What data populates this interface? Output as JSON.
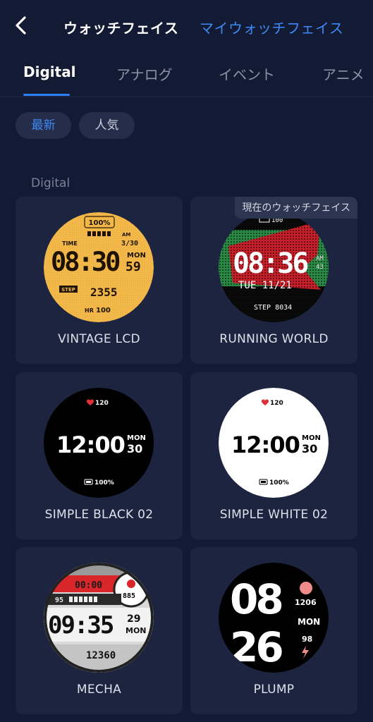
{
  "header": {
    "back_icon": "chevron-left-icon",
    "title": "ウォッチフェイス",
    "my_faces_link": "マイウォッチフェイス"
  },
  "tabs": [
    {
      "label": "Digital",
      "active": true
    },
    {
      "label": "アナログ",
      "active": false
    },
    {
      "label": "イベント",
      "active": false
    },
    {
      "label": "アニメ",
      "active": false
    }
  ],
  "filters": [
    {
      "label": "最新",
      "active": true
    },
    {
      "label": "人気",
      "active": false
    }
  ],
  "section": {
    "label": "Digital"
  },
  "faces": [
    {
      "name": "VINTAGE LCD",
      "current": false,
      "screen": {
        "battery": "100%",
        "time_label": "TIME",
        "date": "3/30",
        "ampm": "AM",
        "time": "08:30",
        "day": "MON",
        "seconds": "59",
        "step_label": "STEP",
        "steps": "2355",
        "hr_label": "HR",
        "hr": "100"
      }
    },
    {
      "name": "RUNNING WORLD",
      "current": true,
      "badge": "現在のウォッチフェイス",
      "screen": {
        "battery": "100",
        "time": "08:36",
        "ampm": "AM",
        "seconds": "43",
        "date": "TUE 11/21",
        "steps": "STEP 8034"
      }
    },
    {
      "name": "SIMPLE BLACK 02",
      "current": false,
      "screen": {
        "heart": "120",
        "time": "12:00",
        "day": "MON",
        "date": "30",
        "battery": "100%"
      }
    },
    {
      "name": "SIMPLE WHITE 02",
      "current": false,
      "screen": {
        "heart": "120",
        "time": "12:00",
        "day": "MON",
        "date": "30",
        "battery": "100%"
      }
    },
    {
      "name": "MECHA",
      "current": false,
      "screen": {
        "top_time": "00:00",
        "kcal": "885",
        "battery": "95",
        "time": "09:35",
        "date": "29",
        "day": "MON",
        "steps": "12360"
      }
    },
    {
      "name": "PLUMP",
      "current": false,
      "screen": {
        "hour": "08",
        "minute": "26",
        "steps": "1206",
        "day": "MON",
        "battery": "98"
      }
    }
  ],
  "colors": {
    "background": "#131a33",
    "card": "#1c2440",
    "accent": "#3d8af7",
    "lcd_amber": "#f2b84a",
    "running_red": "#c8202a",
    "running_green": "#2a9a4a",
    "mecha_red": "#d8262b"
  }
}
